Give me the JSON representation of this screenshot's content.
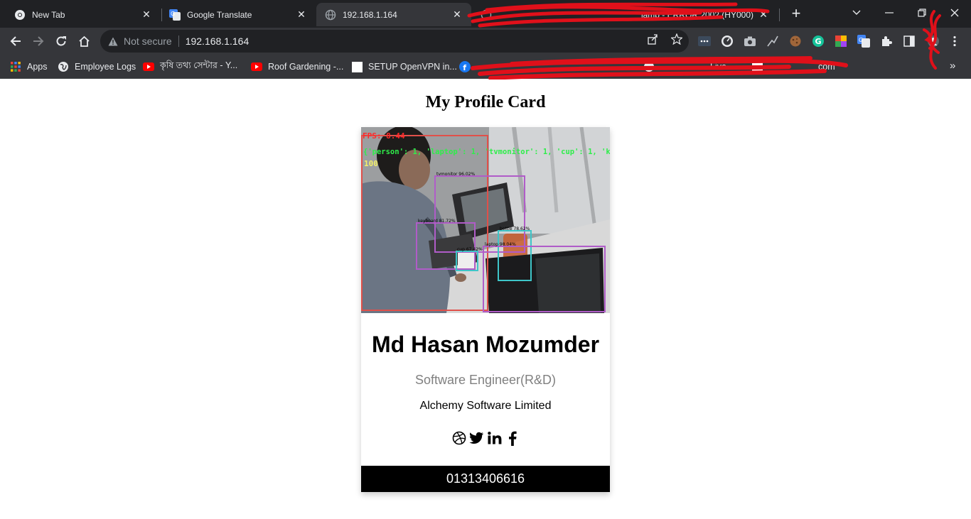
{
  "browser": {
    "tabs": [
      {
        "title": "New Tab",
        "favicon": "chrome-icon"
      },
      {
        "title": "Google Translate",
        "favicon": "google-translate-icon"
      },
      {
        "title": "192.168.1.164",
        "favicon": "globe-icon",
        "active": true
      },
      {
        "title": "lamp - ERROR 2002 (HY000)",
        "favicon": "globe-icon"
      }
    ],
    "address_bar": {
      "security_label": "Not secure",
      "url": "192.168.1.164"
    },
    "bookmarks": [
      {
        "label": "Apps",
        "icon": "apps-grid-icon"
      },
      {
        "label": "Employee Logs",
        "icon": "globe-icon"
      },
      {
        "label": "কৃষি তথ্য সেন্টার - Y...",
        "icon": "youtube-icon"
      },
      {
        "label": "Roof Gardening -...",
        "icon": "youtube-icon"
      },
      {
        "label": "SETUP OpenVPN in...",
        "icon": "page-icon"
      },
      {
        "label": "Live",
        "icon": "globe-icon"
      },
      {
        "label": "com",
        "icon": "globe-icon"
      }
    ],
    "colors": {
      "frame": "#202124",
      "toolbar": "#35363a",
      "text": "#e8eaed"
    }
  },
  "page": {
    "title": "My Profile Card",
    "photo": {
      "fps_label": "FPS: 8.44",
      "counts_label": "{'person': 1, 'laptop': 1, 'tvmonitor': 1, 'cup': 1, 'k",
      "count_number": "100",
      "detections": [
        {
          "label": "tvmonitor 96.02%",
          "color": "#b05cc8"
        },
        {
          "label": "keyboard 81.72%",
          "color": "#b05cc8"
        },
        {
          "label": "bottle 78.62%",
          "color": "#3ec5c8"
        },
        {
          "label": "cup 67.42%",
          "color": "#3ec5c8"
        },
        {
          "label": "laptop 98.04%",
          "color": "#b05cc8"
        }
      ]
    },
    "card": {
      "name": "Md Hasan Mozumder",
      "role": "Software Engineer(R&D)",
      "company": "Alchemy Software Limited",
      "socials": [
        "dribbble-icon",
        "twitter-icon",
        "linkedin-icon",
        "facebook-icon"
      ],
      "phone": "01313406616"
    }
  }
}
